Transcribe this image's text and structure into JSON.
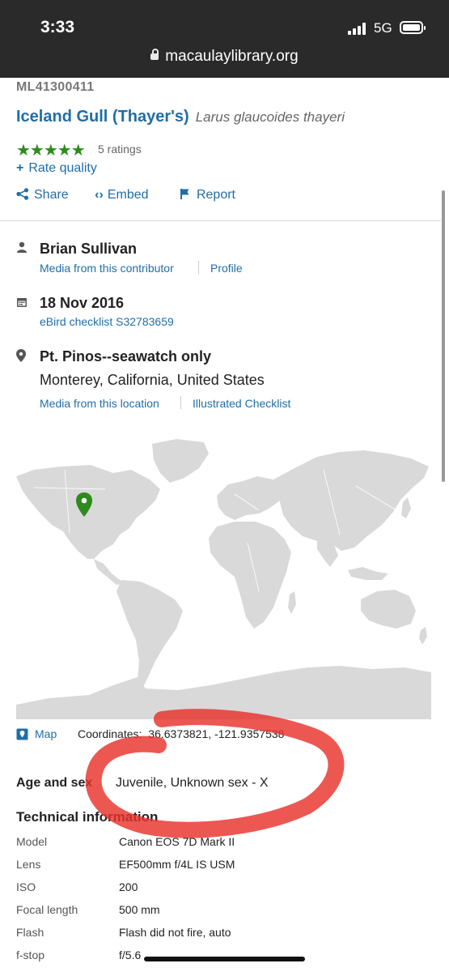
{
  "status_bar": {
    "time": "3:33",
    "network": "5G",
    "url": "macaulaylibrary.org"
  },
  "asset": {
    "id": "ML41300411",
    "common_name": "Iceland Gull (Thayer's)",
    "scientific_name": "Larus glaucoides thayeri",
    "stars": "★★★★★",
    "star_rating": 5,
    "ratings_text": "5 ratings",
    "rate_quality": "Rate quality"
  },
  "actions": {
    "share": "Share",
    "embed": "Embed",
    "report": "Report"
  },
  "contributor": {
    "name": "Brian Sullivan",
    "media_link": "Media from this contributor",
    "profile_link": "Profile"
  },
  "date": {
    "value": "18 Nov 2016",
    "checklist_link": "eBird checklist S32783659"
  },
  "location": {
    "name": "Pt. Pinos--seawatch only",
    "region": "Monterey, California, United States",
    "media_link": "Media from this location",
    "checklist_link": "Illustrated Checklist"
  },
  "map": {
    "link": "Map",
    "coordinates_label": "Coordinates:",
    "coordinates_value": "36.6373821, -121.9357538",
    "land_color": "#d9d9d9",
    "pin_color": "#2f8a1e"
  },
  "details": {
    "age_sex_label": "Age and sex",
    "age_sex_value": "Juvenile, Unknown sex - X",
    "technical_title": "Technical information",
    "rows": [
      {
        "label": "Model",
        "value": "Canon EOS 7D Mark II"
      },
      {
        "label": "Lens",
        "value": "EF500mm f/4L IS USM"
      },
      {
        "label": "ISO",
        "value": "200"
      },
      {
        "label": "Focal length",
        "value": "500 mm"
      },
      {
        "label": "Flash",
        "value": "Flash did not fire, auto"
      },
      {
        "label": "f-stop",
        "value": "f/5.6"
      }
    ]
  },
  "colors": {
    "link": "#1f6ea8",
    "star": "#2f8a1e",
    "annotation": "#e8322c"
  }
}
